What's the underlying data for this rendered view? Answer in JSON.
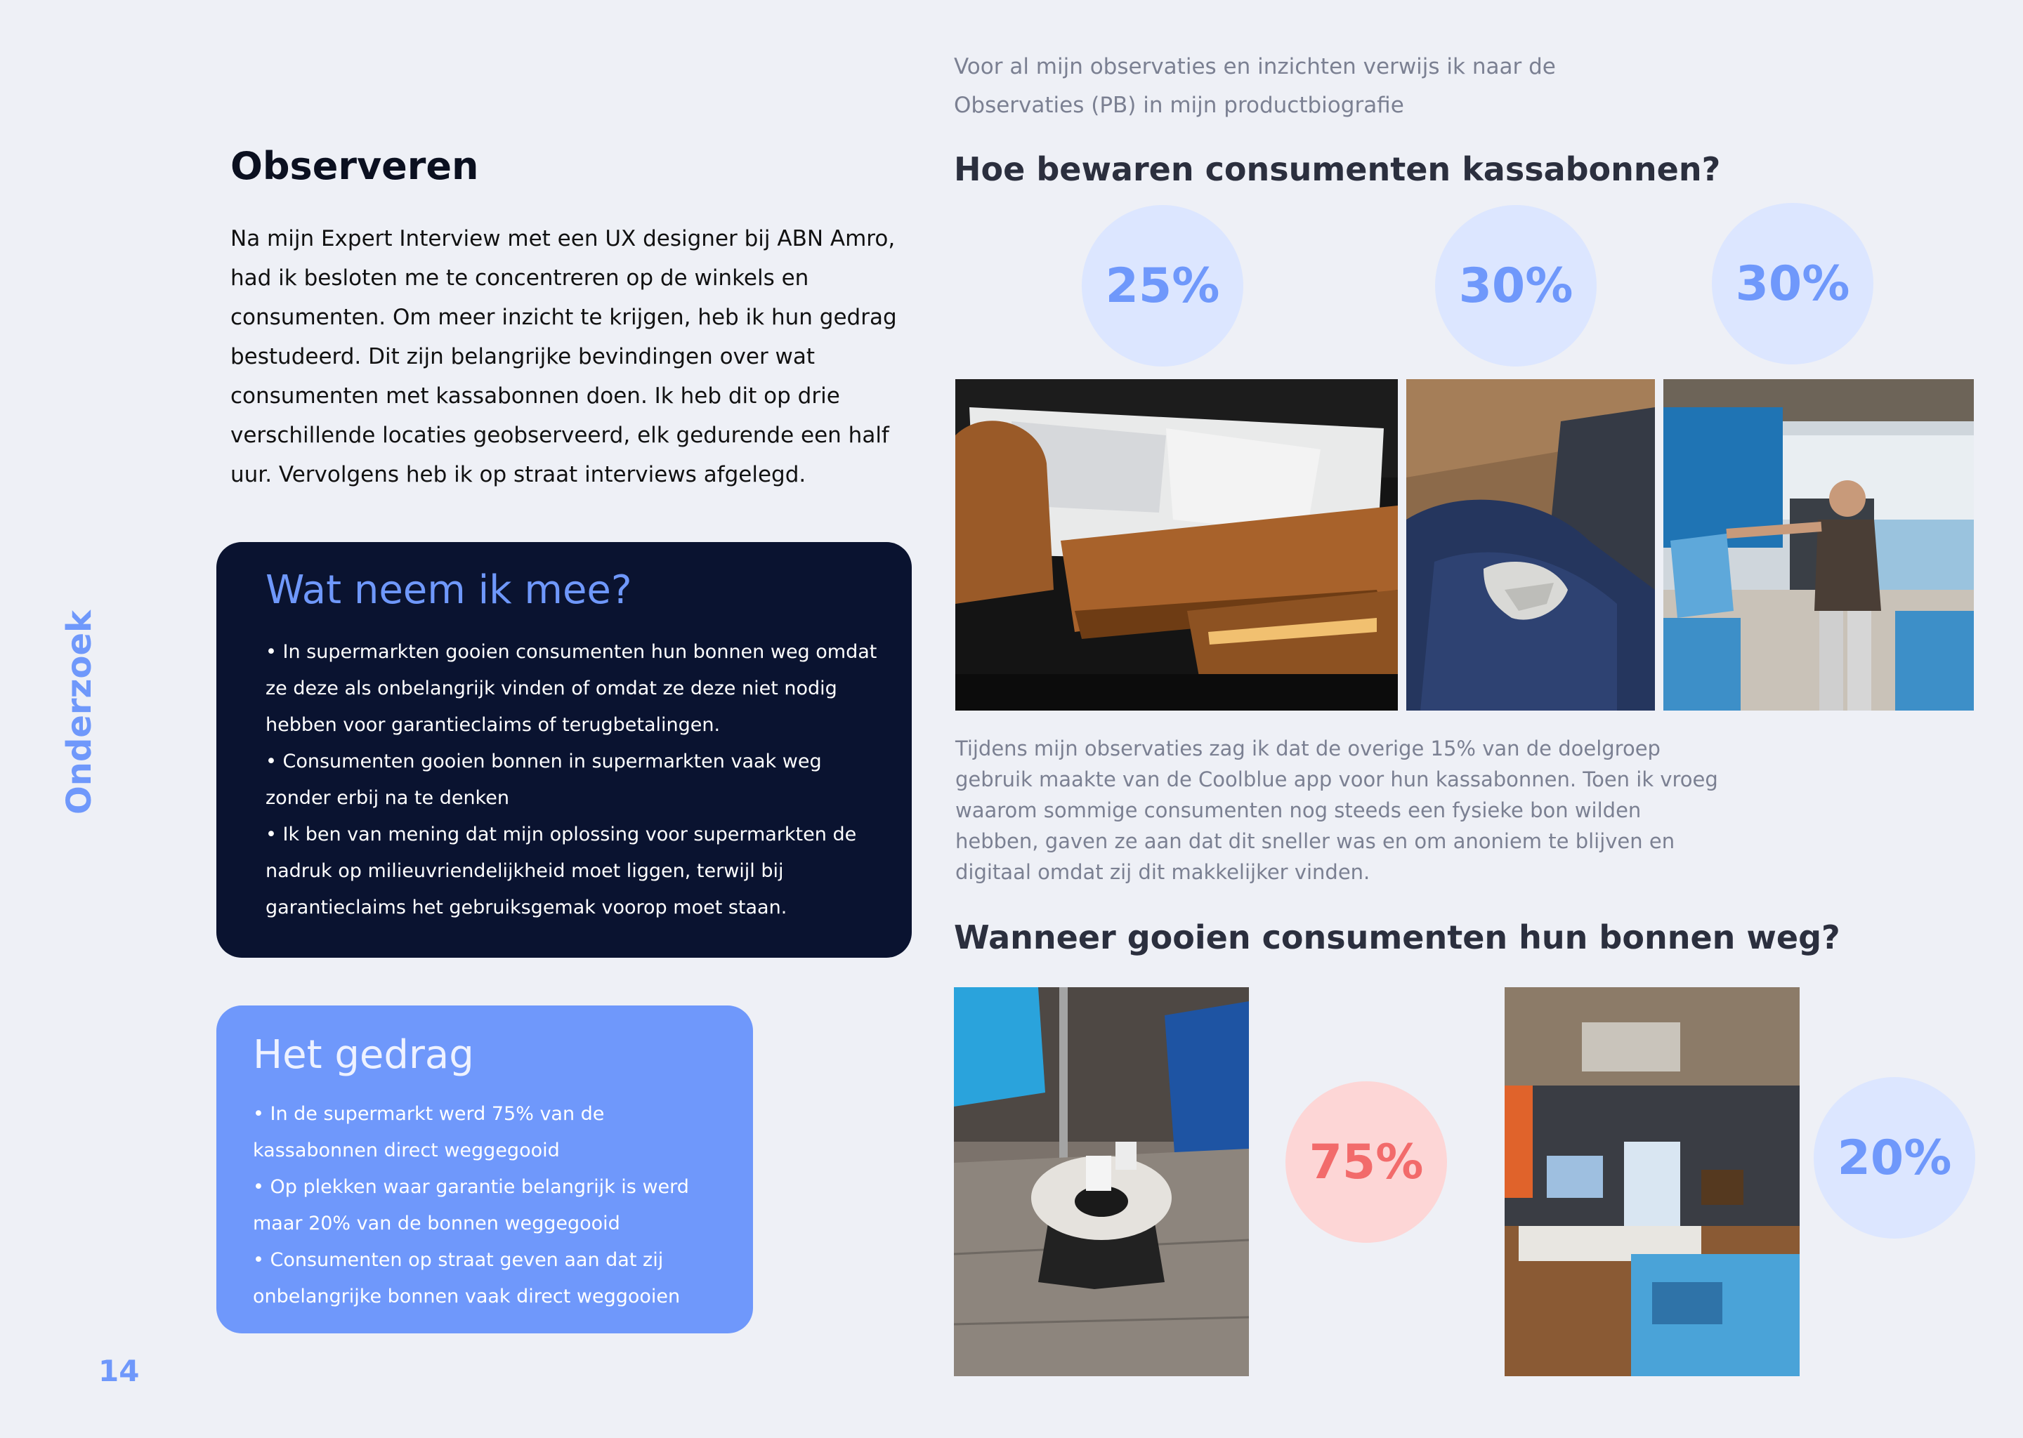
{
  "side_label": "Onderzoek",
  "page_number": "14",
  "left": {
    "title": "Observeren",
    "intro": "Na mijn Expert Interview met een UX designer bij ABN Amro, had ik besloten me te concentreren op de winkels en consumenten. Om meer inzicht te krijgen, heb ik hun gedrag bestudeerd. Dit zijn belangrijke bevindingen over wat consumenten met kassabonnen doen. Ik heb dit op drie verschillende locaties geobserveerd, elk gedurende een half uur. Vervolgens heb ik op straat interviews afgelegd.",
    "takeaway": {
      "title": "Wat neem ik mee?",
      "bullets": [
        "• In supermarkten gooien consumenten hun bonnen weg omdat ze deze als onbelangrijk vinden of omdat ze deze niet nodig hebben voor garantieclaims of terugbetalingen.",
        "• Consumenten gooien bonnen in supermarkten vaak weg zonder erbij na te denken",
        "• Ik ben van mening dat mijn oplossing voor supermarkten de nadruk op milieuvriendelijkheid moet liggen, terwijl bij garantieclaims het gebruiksgemak voorop moet staan."
      ]
    },
    "behaviour": {
      "title": "Het gedrag",
      "bullets": [
        "• In de supermarkt werd 75% van de kassabonnen direct weggegooid",
        "•  Op plekken waar garantie belangrijk is werd maar 20% van de bonnen weggegooid",
        "•  Consumenten op straat geven aan dat zij onbelangrijke bonnen vaak direct weggooien"
      ]
    }
  },
  "right": {
    "note": "Voor al mijn observaties en inzichten verwijs ik naar de Observaties (PB) in mijn productbiografie",
    "section1": {
      "heading": "Hoe bewaren consumenten kassabonnen?",
      "stats": [
        "25%",
        "30%",
        "30%"
      ],
      "stat_values": [
        25,
        30,
        30
      ],
      "photos": [
        "wallet-with-receipts-photo",
        "receipt-in-jeans-pocket-photo",
        "coolblue-store-bag-photo"
      ]
    },
    "observation": "Tijdens mijn observaties zag ik dat de overige 15% van de doelgroep gebruik maakte van de Coolblue app voor hun kassabonnen. Toen ik vroeg waarom sommige consumenten nog steeds een fysieke bon wilden hebben, gaven ze aan dat dit sneller was en om anoniem te blijven en digitaal omdat zij dit makkelijker vinden.",
    "section2": {
      "heading": "Wanneer gooien consumenten hun bonnen weg?",
      "stats": [
        "75%",
        "20%"
      ],
      "stat_values": [
        75,
        20
      ],
      "photos": [
        "supermarket-bin-photo",
        "electronics-store-interior-photo"
      ]
    }
  },
  "colors": {
    "background": "#eef0f6",
    "accent_blue": "#6f98fb",
    "dark_navy": "#0a1330",
    "light_blue_circle": "#dce6ff",
    "pink_circle": "#fdd6d6",
    "pink_text": "#f26b6b",
    "muted_text": "#7b8092"
  }
}
